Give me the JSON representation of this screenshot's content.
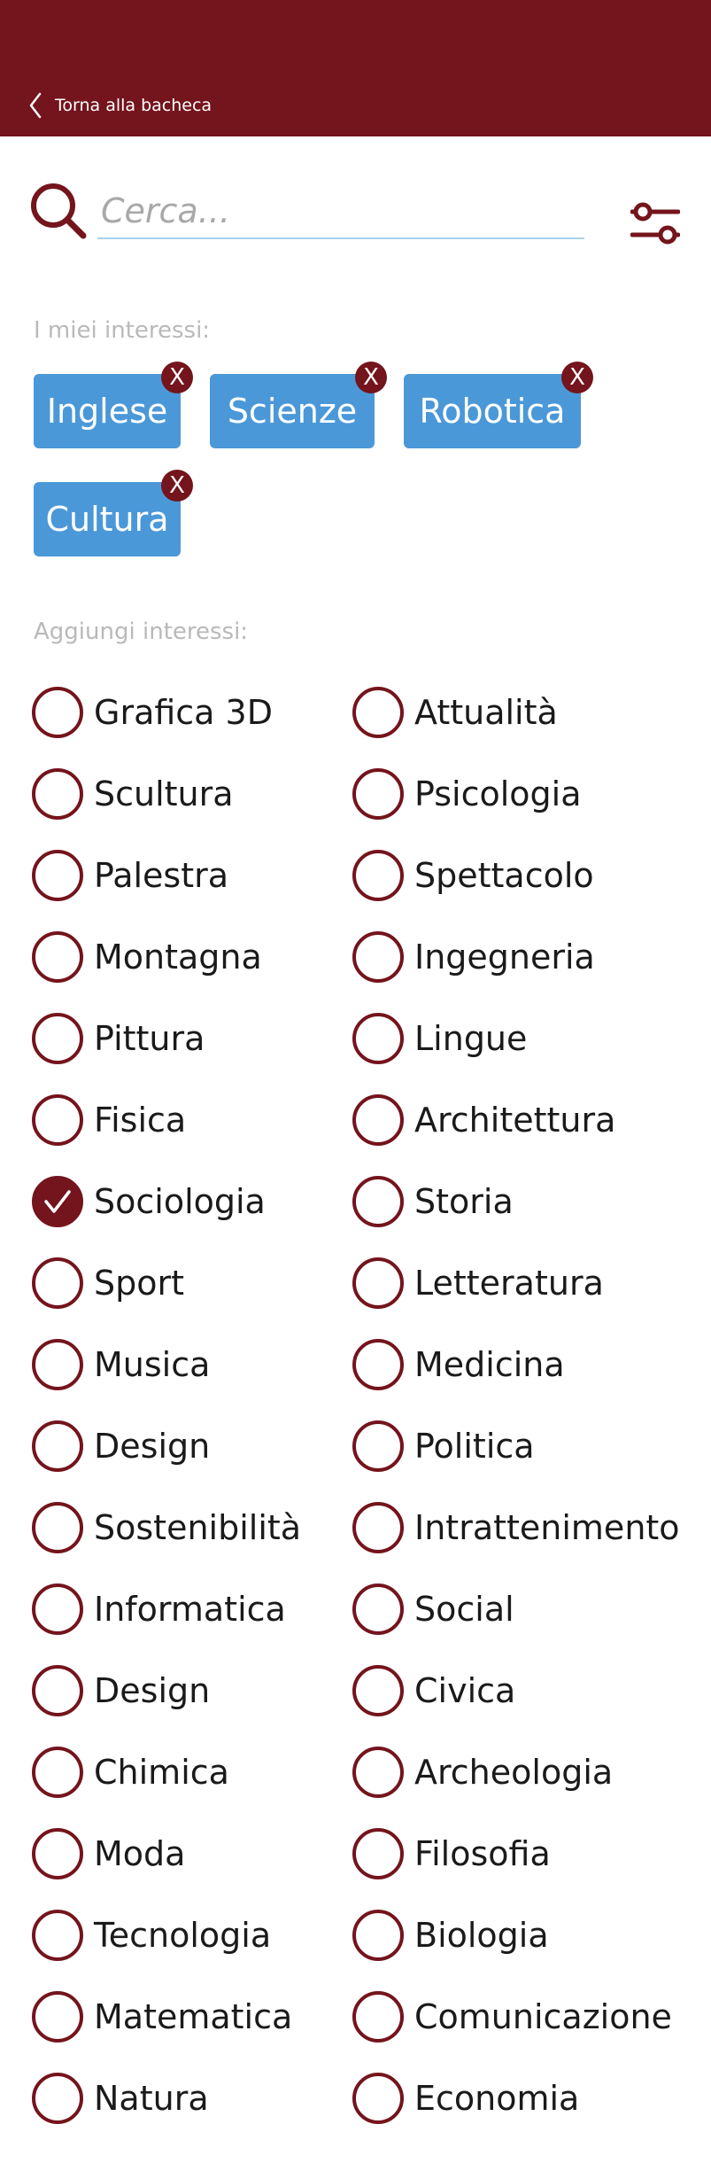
{
  "header": {
    "back_label": "Torna alla bacheca"
  },
  "search": {
    "placeholder": "Cerca..."
  },
  "interests": {
    "label": "I miei interessi:",
    "tags": [
      {
        "label": "Inglese",
        "remove": "X"
      },
      {
        "label": "Scienze",
        "remove": "X"
      },
      {
        "label": "Robotica",
        "remove": "X"
      },
      {
        "label": "Cultura",
        "remove": "X"
      }
    ]
  },
  "add": {
    "label": "Aggiungi interessi:",
    "options": [
      {
        "label": "Grafica 3D",
        "checked": false
      },
      {
        "label": "Attualità",
        "checked": false
      },
      {
        "label": "Scultura",
        "checked": false
      },
      {
        "label": "Psicologia",
        "checked": false
      },
      {
        "label": "Palestra",
        "checked": false
      },
      {
        "label": "Spettacolo",
        "checked": false
      },
      {
        "label": "Montagna",
        "checked": false
      },
      {
        "label": "Ingegneria",
        "checked": false
      },
      {
        "label": "Pittura",
        "checked": false
      },
      {
        "label": "Lingue",
        "checked": false
      },
      {
        "label": "Fisica",
        "checked": false
      },
      {
        "label": "Architettura",
        "checked": false
      },
      {
        "label": "Sociologia",
        "checked": true
      },
      {
        "label": "Storia",
        "checked": false
      },
      {
        "label": "Sport",
        "checked": false
      },
      {
        "label": "Letteratura",
        "checked": false
      },
      {
        "label": "Musica",
        "checked": false
      },
      {
        "label": "Medicina",
        "checked": false
      },
      {
        "label": "Design",
        "checked": false
      },
      {
        "label": "Politica",
        "checked": false
      },
      {
        "label": "Sostenibilità",
        "checked": false
      },
      {
        "label": "Intrattenimento",
        "checked": false
      },
      {
        "label": "Informatica",
        "checked": false
      },
      {
        "label": "Social",
        "checked": false
      },
      {
        "label": "Design",
        "checked": false
      },
      {
        "label": "Civica",
        "checked": false
      },
      {
        "label": "Chimica",
        "checked": false
      },
      {
        "label": "Archeologia",
        "checked": false
      },
      {
        "label": "Moda",
        "checked": false
      },
      {
        "label": "Filosofia",
        "checked": false
      },
      {
        "label": "Tecnologia",
        "checked": false
      },
      {
        "label": "Biologia",
        "checked": false
      },
      {
        "label": "Matematica",
        "checked": false
      },
      {
        "label": "Comunicazione",
        "checked": false
      },
      {
        "label": "Natura",
        "checked": false
      },
      {
        "label": "Economia",
        "checked": false
      }
    ]
  },
  "colors": {
    "primary": "#74141c",
    "tag": "#4b98d8",
    "muted": "#b9b9b9",
    "underline": "#a9d3ee"
  }
}
